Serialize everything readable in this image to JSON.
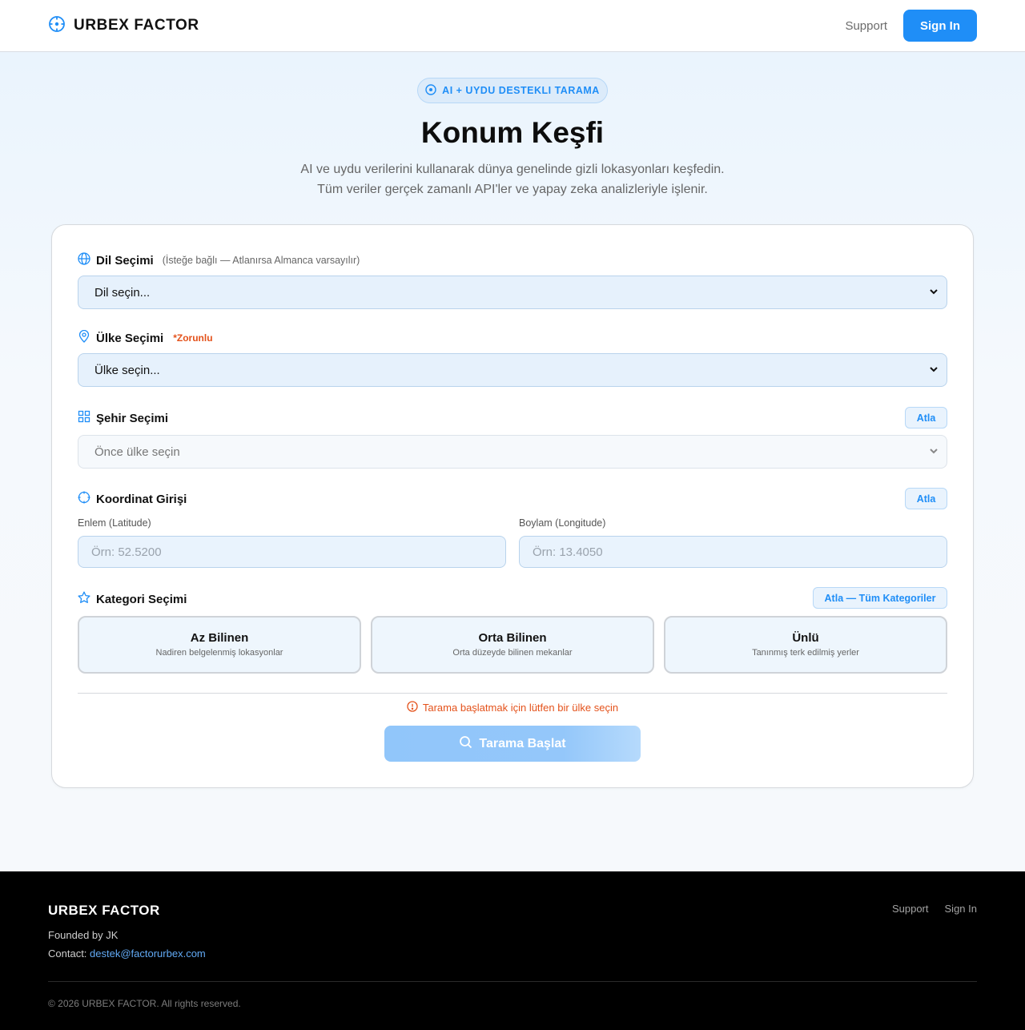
{
  "header": {
    "brand": "URBEX FACTOR",
    "nav": {
      "support": "Support",
      "sign_in": "Sign In"
    }
  },
  "hero": {
    "badge": "AI + UYDU DESTEKLI TARAMA",
    "title": "Konum Keşfi",
    "subtitle_line1": "AI ve uydu verilerini kullanarak dünya genelinde gizli lokasyonları keşfedin.",
    "subtitle_line2": "Tüm veriler gerçek zamanlı API'ler ve yapay zeka analizleriyle işlenir."
  },
  "form": {
    "language": {
      "label": "Dil Seçimi",
      "hint": "(İsteğe bağlı — Atlanırsa Almanca varsayılır)",
      "value": "Dil seçin..."
    },
    "country": {
      "label": "Ülke Seçimi",
      "required": "*Zorunlu",
      "value": "Ülke seçin..."
    },
    "city": {
      "label": "Şehir Seçimi",
      "skip": "Atla",
      "value": "Önce ülke seçin"
    },
    "coordinates": {
      "label": "Koordinat Girişi",
      "skip": "Atla",
      "lat_label": "Enlem (Latitude)",
      "lat_placeholder": "Örn: 52.5200",
      "lon_label": "Boylam (Longitude)",
      "lon_placeholder": "Örn: 13.4050"
    },
    "category": {
      "label": "Kategori Seçimi",
      "skip": "Atla — Tüm Kategoriler",
      "options": [
        {
          "title": "Az Bilinen",
          "desc": "Nadiren belgelenmiş lokasyonlar"
        },
        {
          "title": "Orta Bilinen",
          "desc": "Orta düzeyde bilinen mekanlar"
        },
        {
          "title": "Ünlü",
          "desc": "Tanınmış terk edilmiş yerler"
        }
      ]
    },
    "warning": "Tarama başlatmak için lütfen bir ülke seçin",
    "submit": "Tarama Başlat"
  },
  "footer": {
    "brand": "URBEX FACTOR",
    "founded": "Founded by JK",
    "contact_label": "Contact:",
    "email": "destek@factorurbex.com",
    "nav": {
      "support": "Support",
      "sign_in": "Sign In"
    },
    "copyright": "© 2026 URBEX FACTOR. All rights reserved."
  },
  "colors": {
    "accent": "#1f8ef7",
    "warning": "#e4521b",
    "footer_bg": "#000000"
  },
  "icons": {
    "brand": "crosshair-icon",
    "badge": "target-icon",
    "language": "globe-icon",
    "country": "map-pin-icon",
    "city": "grid-icon",
    "coordinates": "crosshair-icon",
    "category": "star-icon",
    "warning": "alert-circle-icon",
    "submit": "search-icon",
    "select": "chevron-down-icon"
  }
}
